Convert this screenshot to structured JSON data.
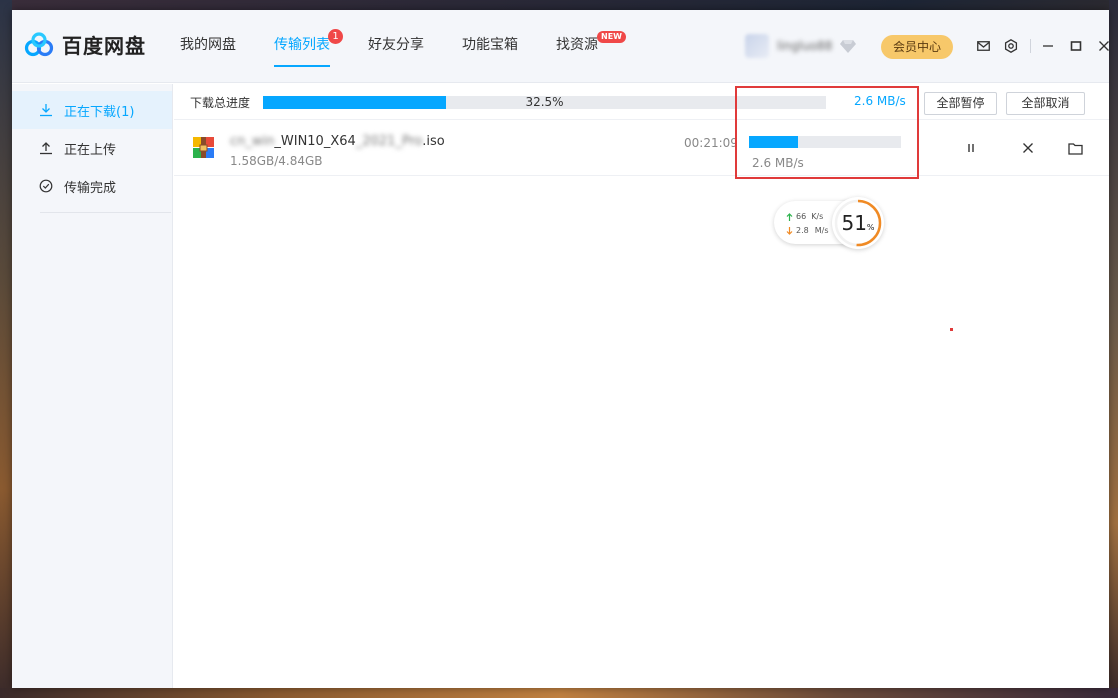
{
  "app": {
    "name": "百度网盘",
    "accent_color": "#06a7ff"
  },
  "nav": {
    "items": [
      {
        "label": "我的网盘"
      },
      {
        "label": "传输列表",
        "badge": "1",
        "active": true
      },
      {
        "label": "好友分享"
      },
      {
        "label": "功能宝箱"
      },
      {
        "label": "找资源",
        "badge": "NEW"
      }
    ]
  },
  "user": {
    "name": "lingluo88",
    "member_button": "会员中心"
  },
  "sidebar": {
    "items": [
      {
        "label": "正在下载(1)",
        "icon": "download-icon",
        "active": true
      },
      {
        "label": "正在上传",
        "icon": "upload-icon"
      },
      {
        "label": "传输完成",
        "icon": "check-circle-icon"
      }
    ]
  },
  "summary": {
    "label": "下载总进度",
    "progress_text": "32.5%",
    "progress": 0.325,
    "speed": "2.6 MB/s",
    "pause_all": "全部暂停",
    "cancel_all": "全部取消"
  },
  "downloads": [
    {
      "name_prefix": "cn_win",
      "name_mid": "_WIN10_X64",
      "name_blur": "_2021_Pro",
      "name_ext": ".iso",
      "size": "1.58GB/4.84GB",
      "time": "00:21:09",
      "progress": 0.325,
      "speed": "2.6 MB/s"
    }
  ],
  "speed_widget": {
    "up": "66",
    "up_unit": "K/s",
    "down": "2.8",
    "down_unit": "M/s",
    "percent": "51",
    "percent_sign": "%",
    "percent_value": 51
  }
}
